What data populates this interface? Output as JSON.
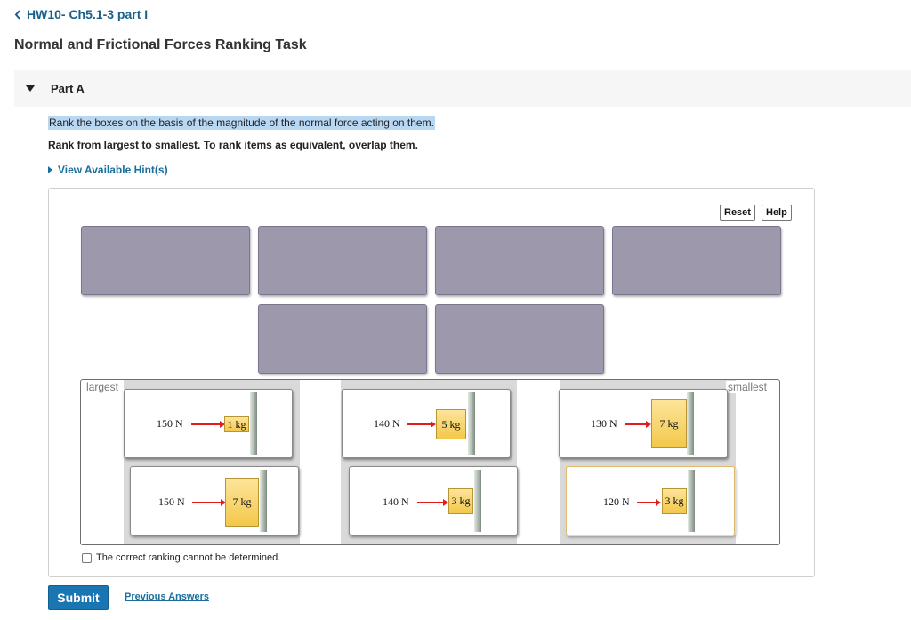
{
  "header": {
    "back_label": "HW10- Ch5.1-3 part I",
    "title": "Normal and Frictional Forces Ranking Task"
  },
  "part": {
    "label": "Part A"
  },
  "instructions": {
    "question": "Rank the boxes on the basis of the magnitude of the normal force acting on them.",
    "rank_rule": "Rank from largest to smallest. To rank items as equivalent, overlap them.",
    "hints_label": "View Available Hint(s)"
  },
  "toolbar": {
    "reset_label": "Reset",
    "help_label": "Help"
  },
  "tray": {
    "largest_label": "largest",
    "smallest_label": "smallest"
  },
  "cards": [
    {
      "force": "150 N",
      "mass": "1 kg"
    },
    {
      "force": "140 N",
      "mass": "5 kg"
    },
    {
      "force": "130 N",
      "mass": "7 kg"
    },
    {
      "force": "150 N",
      "mass": "7 kg"
    },
    {
      "force": "140 N",
      "mass": "3 kg"
    },
    {
      "force": "120 N",
      "mass": "3 kg"
    }
  ],
  "checkbox": {
    "label": "The correct ranking cannot be determined."
  },
  "footer": {
    "submit_label": "Submit",
    "previous_label": "Previous Answers"
  },
  "colors": {
    "link": "#1a6f9c",
    "slot": "#9d98ab",
    "submit": "#1a75b3",
    "arrow": "#e21b1b"
  }
}
